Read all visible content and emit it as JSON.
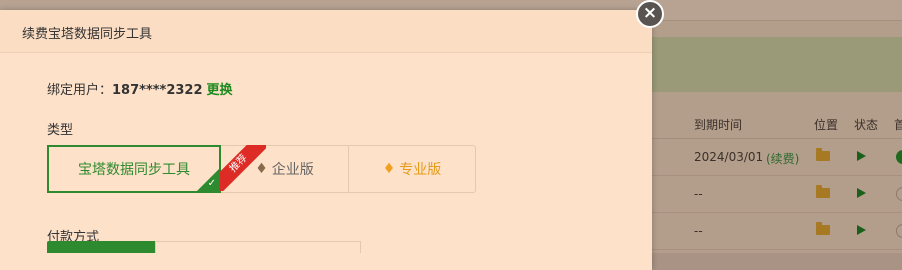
{
  "background": {
    "table_header": {
      "expire": "到期时间",
      "location": "位置",
      "status": "状态",
      "more": "首"
    },
    "rows": [
      {
        "expire": "2024/03/01",
        "renew": "(续费)"
      },
      {
        "expire": "--"
      },
      {
        "expire": "--"
      }
    ]
  },
  "dialog": {
    "title": "续费宝塔数据同步工具",
    "close_symbol": "×",
    "bind_label": "绑定用户：",
    "bind_phone": "187****2322",
    "bind_change": "更换",
    "type_label": "类型",
    "types": [
      {
        "label": "宝塔数据同步工具",
        "selected": true
      },
      {
        "label": "企业版",
        "icon": "diamond-icon"
      },
      {
        "label": "专业版",
        "icon": "diamond-icon"
      }
    ],
    "recommend_badge": "推荐",
    "pay_label": "付款方式"
  },
  "colors": {
    "accent_green": "#2e8a2e",
    "ribbon_red": "#dd2b25",
    "gold": "#e89a1a"
  }
}
